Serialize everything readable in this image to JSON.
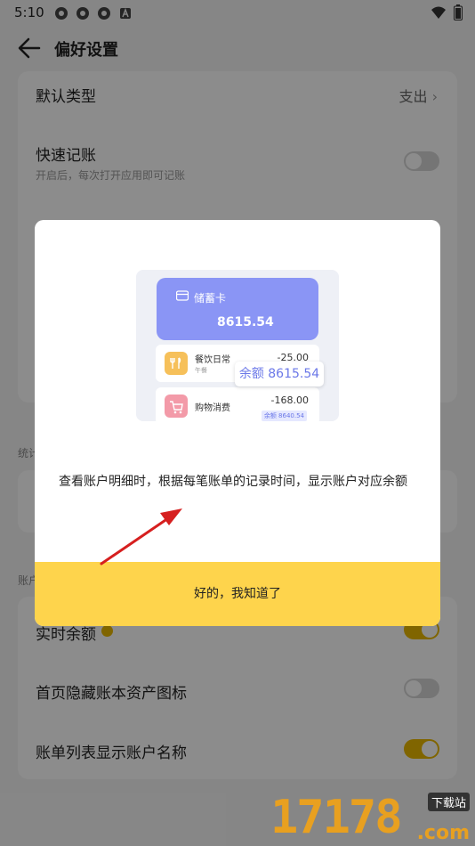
{
  "status": {
    "time": "5:10"
  },
  "header": {
    "title": "偏好设置"
  },
  "settings": {
    "default_type": {
      "label": "默认类型",
      "value": "支出"
    },
    "quick_record": {
      "label": "快速记账",
      "sub": "开启后，每次打开应用即可记账",
      "on": false
    },
    "section_stats": "统计",
    "section_account": "账户",
    "realtime_balance": {
      "label": "实时余额",
      "on": true
    },
    "hide_asset_icon": {
      "label": "首页隐藏账本资产图标",
      "on": false
    },
    "show_account_name": {
      "label": "账单列表显示账户名称",
      "on": true
    }
  },
  "dialog": {
    "illustration": {
      "card_name": "储蓄卡",
      "card_amount": "8615.54",
      "tx1": {
        "name": "餐饮日常",
        "sub": "午餐",
        "amount": "-25.00"
      },
      "tx2": {
        "name": "购物消费",
        "amount": "-168.00",
        "balance_small": "余额 8640.54"
      },
      "balance_badge": "余额 8615.54"
    },
    "description": "查看账户明细时，根据每笔账单的记录时间，显示账户对应余额",
    "ok_label": "好的，我知道了"
  },
  "watermark": {
    "digits": "17178",
    "site": "下载站",
    "com": ".com"
  },
  "colors": {
    "accent": "#fed44c",
    "toggle_on": "#e9b800",
    "card_blue": "#8a95f5",
    "arrow": "#d61f1f"
  }
}
